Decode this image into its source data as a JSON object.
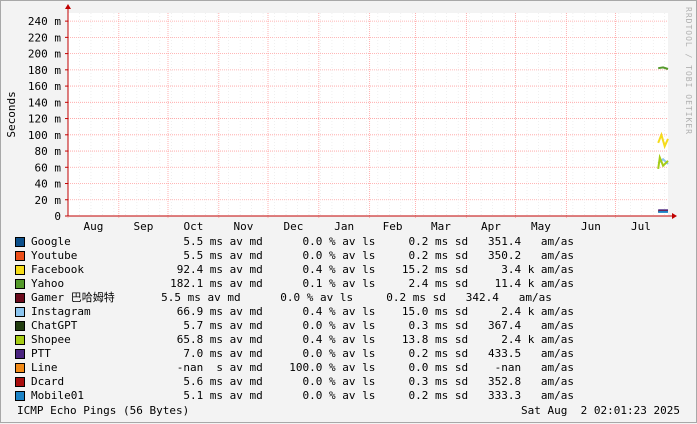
{
  "chart_data": {
    "type": "line",
    "ylabel": "Seconds",
    "ylim": [
      0,
      0.25
    ],
    "y_ticks": [
      {
        "v": 0,
        "label": "0"
      },
      {
        "v": 0.02,
        "label": "20 m"
      },
      {
        "v": 0.04,
        "label": "40 m"
      },
      {
        "v": 0.06,
        "label": "60 m"
      },
      {
        "v": 0.08,
        "label": "80 m"
      },
      {
        "v": 0.1,
        "label": "100 m"
      },
      {
        "v": 0.12,
        "label": "120 m"
      },
      {
        "v": 0.14,
        "label": "140 m"
      },
      {
        "v": 0.16,
        "label": "160 m"
      },
      {
        "v": 0.18,
        "label": "180 m"
      },
      {
        "v": 0.2,
        "label": "200 m"
      },
      {
        "v": 0.22,
        "label": "220 m"
      },
      {
        "v": 0.24,
        "label": "240 m"
      }
    ],
    "x_range": [
      "2024-08-01",
      "2025-08-02"
    ],
    "x_ticks": [
      "Aug",
      "Sep",
      "Oct",
      "Nov",
      "Dec",
      "Jan",
      "Feb",
      "Mar",
      "Apr",
      "May",
      "Jun",
      "Jul"
    ],
    "grid": true,
    "series": [
      {
        "name": "Google",
        "color": "#0c4f8a",
        "x": [
          "2025-07-27",
          "2025-08-02"
        ],
        "y": [
          0.0055,
          0.0055
        ]
      },
      {
        "name": "Youtube",
        "color": "#ec4f1a",
        "x": [
          "2025-07-27",
          "2025-08-02"
        ],
        "y": [
          0.0055,
          0.0055
        ]
      },
      {
        "name": "Facebook",
        "color": "#f5dc1b",
        "x": [
          "2025-07-27",
          "2025-07-29",
          "2025-07-31",
          "2025-08-02"
        ],
        "y": [
          0.09,
          0.1,
          0.086,
          0.095
        ]
      },
      {
        "name": "Yahoo",
        "color": "#549a2b",
        "x": [
          "2025-07-27",
          "2025-07-30",
          "2025-08-02"
        ],
        "y": [
          0.182,
          0.183,
          0.181
        ]
      },
      {
        "name": "Gamer 巴哈姆特",
        "color": "#6b0a1c",
        "x": [
          "2025-07-27",
          "2025-08-02"
        ],
        "y": [
          0.0055,
          0.0055
        ]
      },
      {
        "name": "Instagram",
        "color": "#8cc5ef",
        "x": [
          "2025-07-27",
          "2025-07-30",
          "2025-08-02"
        ],
        "y": [
          0.065,
          0.07,
          0.064
        ]
      },
      {
        "name": "ChatGPT",
        "color": "#223d10",
        "x": [
          "2025-07-27",
          "2025-08-02"
        ],
        "y": [
          0.0057,
          0.0057
        ]
      },
      {
        "name": "Shopee",
        "color": "#a6cc16",
        "x": [
          "2025-07-27",
          "2025-07-28",
          "2025-07-30",
          "2025-08-02"
        ],
        "y": [
          0.058,
          0.072,
          0.062,
          0.068
        ]
      },
      {
        "name": "PTT",
        "color": "#4a2480",
        "x": [
          "2025-07-27",
          "2025-08-02"
        ],
        "y": [
          0.007,
          0.007
        ]
      },
      {
        "name": "Line",
        "color": "#f28a18",
        "x": [],
        "y": []
      },
      {
        "name": "Dcard",
        "color": "#a80d0d",
        "x": [
          "2025-07-27",
          "2025-08-02"
        ],
        "y": [
          0.0056,
          0.0056
        ]
      },
      {
        "name": "Mobile01",
        "color": "#1c83c6",
        "x": [
          "2025-07-27",
          "2025-08-02"
        ],
        "y": [
          0.0051,
          0.0051
        ]
      }
    ]
  },
  "legend": [
    {
      "color": "#0c4f8a",
      "text": "Google                 5.5 ms av md      0.0 % av ls     0.2 ms sd   351.4   am/as"
    },
    {
      "color": "#ec4f1a",
      "text": "Youtube                5.5 ms av md      0.0 % av ls     0.2 ms sd   350.2   am/as"
    },
    {
      "color": "#f5dc1b",
      "text": "Facebook              92.4 ms av md      0.4 % av ls    15.2 ms sd     3.4 k am/as"
    },
    {
      "color": "#549a2b",
      "text": "Yahoo                182.1 ms av md      0.1 % av ls     2.4 ms sd    11.4 k am/as"
    },
    {
      "color": "#6b0a1c",
      "text": "Gamer 巴哈姆特       5.5 ms av md      0.0 % av ls     0.2 ms sd   342.4   am/as"
    },
    {
      "color": "#8cc5ef",
      "text": "Instagram             66.9 ms av md      0.4 % av ls    15.0 ms sd     2.4 k am/as"
    },
    {
      "color": "#223d10",
      "text": "ChatGPT                5.7 ms av md      0.0 % av ls     0.3 ms sd   367.4   am/as"
    },
    {
      "color": "#a6cc16",
      "text": "Shopee                65.8 ms av md      0.4 % av ls    13.8 ms sd     2.4 k am/as"
    },
    {
      "color": "#4a2480",
      "text": "PTT                    7.0 ms av md      0.0 % av ls     0.2 ms sd   433.5   am/as"
    },
    {
      "color": "#f28a18",
      "text": "Line                  -nan  s av md    100.0 % av ls     0.0 ms sd    -nan   am/as"
    },
    {
      "color": "#a80d0d",
      "text": "Dcard                  5.6 ms av md      0.0 % av ls     0.3 ms sd   352.8   am/as"
    },
    {
      "color": "#1c83c6",
      "text": "Mobile01               5.1 ms av md      0.0 % av ls     0.2 ms sd   333.3   am/as"
    }
  ],
  "footer_left": "ICMP Echo Pings (56 Bytes)",
  "footer_right": "Sat Aug  2 02:01:23 2025",
  "watermark": "RRDTOOL / TOBI OETIKER"
}
